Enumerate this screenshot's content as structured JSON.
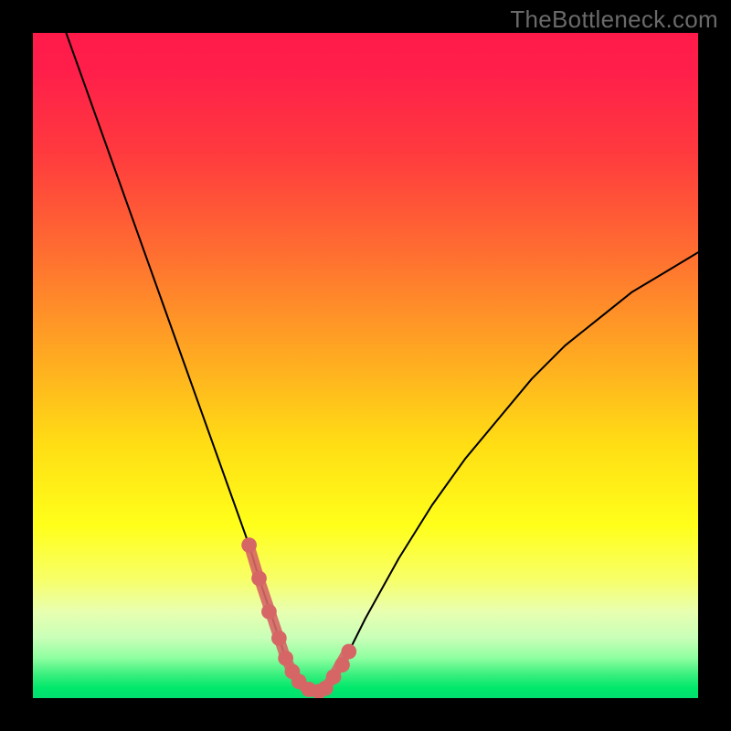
{
  "watermark": {
    "text": "TheBottleneck.com"
  },
  "chart_data": {
    "type": "line",
    "title": "",
    "xlabel": "",
    "ylabel": "",
    "xlim": [
      0,
      100
    ],
    "ylim": [
      0,
      100
    ],
    "grid": false,
    "legend": false,
    "series": [
      {
        "name": "bottleneck-curve",
        "color": "#000000",
        "x": [
          5,
          7.5,
          10,
          12.5,
          15,
          17.5,
          20,
          22.5,
          25,
          27.5,
          30,
          32.5,
          34,
          35,
          36,
          37,
          38,
          39,
          40,
          41,
          42,
          43,
          44,
          45,
          47.5,
          50,
          55,
          60,
          65,
          70,
          75,
          80,
          85,
          90,
          95,
          100
        ],
        "values": [
          100,
          93,
          86,
          79,
          72,
          65,
          58,
          51,
          44,
          37,
          30,
          23,
          18,
          15,
          12,
          9,
          6,
          4,
          2.5,
          1.5,
          1,
          1,
          1.5,
          3,
          7,
          12,
          21,
          29,
          36,
          42,
          48,
          53,
          57,
          61,
          64,
          67
        ]
      },
      {
        "name": "highlighted-zone",
        "color": "#d66666",
        "x": [
          32.5,
          34,
          35,
          36,
          37,
          38,
          39,
          40,
          41,
          42,
          43,
          44,
          45,
          47
        ],
        "values": [
          23,
          18,
          15,
          12,
          9,
          6,
          4,
          2.5,
          1.5,
          1,
          1,
          1.5,
          3,
          6.5
        ]
      }
    ],
    "highlight_markers": {
      "name": "marker-dots",
      "color": "#d66666",
      "x": [
        32.5,
        34,
        35.5,
        37,
        38,
        39,
        40,
        41.5,
        43,
        44,
        45.2,
        46.5,
        47.5
      ],
      "values": [
        23,
        18,
        13,
        9,
        6,
        4,
        2.5,
        1.3,
        1,
        1.5,
        3.2,
        5,
        7
      ]
    },
    "background_gradient": {
      "stops": [
        {
          "pos": 0.0,
          "color": "#ff1a4a"
        },
        {
          "pos": 0.06,
          "color": "#ff1f4a"
        },
        {
          "pos": 0.18,
          "color": "#ff3a3e"
        },
        {
          "pos": 0.32,
          "color": "#ff6a32"
        },
        {
          "pos": 0.48,
          "color": "#ffa722"
        },
        {
          "pos": 0.62,
          "color": "#ffde14"
        },
        {
          "pos": 0.74,
          "color": "#ffff1a"
        },
        {
          "pos": 0.82,
          "color": "#f8ff66"
        },
        {
          "pos": 0.87,
          "color": "#e8ffb0"
        },
        {
          "pos": 0.91,
          "color": "#c8ffb8"
        },
        {
          "pos": 0.94,
          "color": "#8effa0"
        },
        {
          "pos": 0.965,
          "color": "#38ef7d"
        },
        {
          "pos": 0.985,
          "color": "#00e86b"
        },
        {
          "pos": 1.0,
          "color": "#00e070"
        }
      ]
    }
  }
}
